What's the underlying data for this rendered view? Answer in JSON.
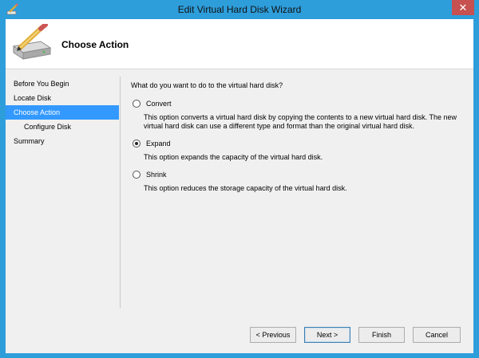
{
  "window": {
    "title": "Edit Virtual Hard Disk Wizard",
    "close_glyph": "✕"
  },
  "header": {
    "title": "Choose Action",
    "icon": "disk-pencil-icon"
  },
  "nav": {
    "items": [
      {
        "label": "Before You Begin"
      },
      {
        "label": "Locate Disk"
      },
      {
        "label": "Choose Action"
      },
      {
        "label": "Configure Disk"
      },
      {
        "label": "Summary"
      }
    ],
    "selected": "Choose Action"
  },
  "content": {
    "question": "What do you want to do to the virtual hard disk?",
    "options": [
      {
        "label": "Convert",
        "checked": false,
        "description": "This option converts a virtual hard disk by copying the contents to a new virtual hard disk. The new virtual hard disk can use a different type and format than the original virtual hard disk."
      },
      {
        "label": "Expand",
        "checked": true,
        "description": "This option expands the capacity of the virtual hard disk."
      },
      {
        "label": "Shrink",
        "checked": false,
        "description": "This option reduces the storage capacity of the virtual hard disk."
      }
    ]
  },
  "buttons": {
    "previous": "< Previous",
    "next": "Next >",
    "finish": "Finish",
    "cancel": "Cancel"
  },
  "colors": {
    "titlebar": "#2e9edb",
    "selection": "#3399ff",
    "close": "#c75050"
  }
}
